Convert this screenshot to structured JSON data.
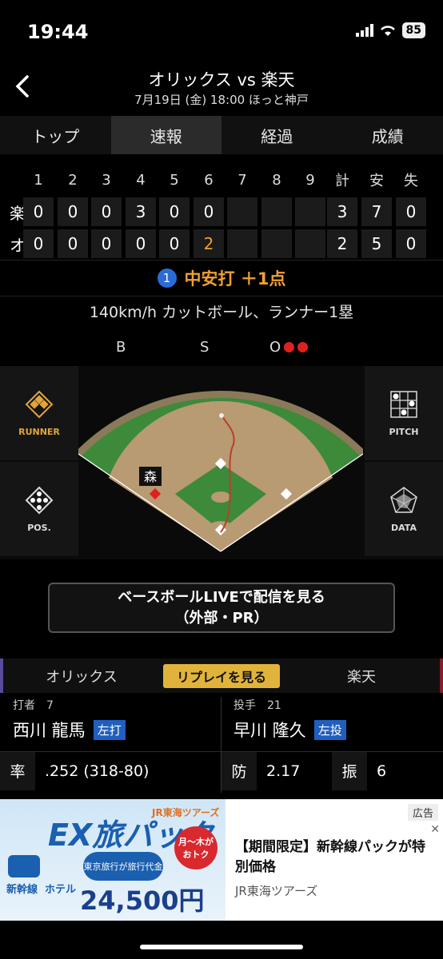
{
  "status": {
    "time": "19:44",
    "battery": "85"
  },
  "header": {
    "title": "オリックス vs 楽天",
    "subtitle": "7月19日 (金) 18:00 ほっと神戸"
  },
  "tabs": [
    "トップ",
    "速報",
    "経過",
    "成績"
  ],
  "scoreboard": {
    "headers": [
      "1",
      "2",
      "3",
      "4",
      "5",
      "6",
      "7",
      "8",
      "9",
      "計",
      "安",
      "失"
    ],
    "rows": [
      {
        "team": "楽",
        "innings": [
          "0",
          "0",
          "0",
          "3",
          "0",
          "0",
          "",
          "",
          ""
        ],
        "totals": [
          "3",
          "7",
          "0"
        ]
      },
      {
        "team": "オ",
        "innings": [
          "0",
          "0",
          "0",
          "0",
          "0",
          "2",
          "",
          "",
          ""
        ],
        "totals": [
          "2",
          "5",
          "0"
        ]
      }
    ]
  },
  "play": {
    "outs": "1",
    "text": "中安打 ＋1点",
    "description": "140km/h カットボール、ランナー1塁"
  },
  "bso": {
    "b": "B",
    "s": "S",
    "o": "O",
    "outs_count": 2
  },
  "field": {
    "runner_label": "森"
  },
  "side_buttons": {
    "runner": "RUNNER",
    "pos": "POS.",
    "pitch": "PITCH",
    "data": "DATA"
  },
  "live_button": {
    "line1": "ベースボールLIVEで配信を見る",
    "line2": "（外部・PR）"
  },
  "team_bar": {
    "left": "オリックス",
    "replay": "リプレイを見る",
    "right": "楽天"
  },
  "batter": {
    "role": "打者　7",
    "name": "西川 龍馬",
    "hand": "左打",
    "stat_label": "率",
    "stat_value": ".252 (318-80)"
  },
  "pitcher": {
    "role": "投手　21",
    "name": "早川 隆久",
    "hand": "左投",
    "stat1_label": "防",
    "stat1_value": "2.17",
    "stat2_label": "振",
    "stat2_value": "6"
  },
  "ad": {
    "tag": "広告",
    "brand": "JR東海ツアーズ",
    "headline": "EX旅パック",
    "days": "月〜木がおトク",
    "line1": "新幹線",
    "line2": "ホテル",
    "promo": "東京旅行が旅行代金",
    "price": "24,500円",
    "text": "【期間限定】新幹線パックが特別価格",
    "sponsor": "JR東海ツアーズ"
  }
}
